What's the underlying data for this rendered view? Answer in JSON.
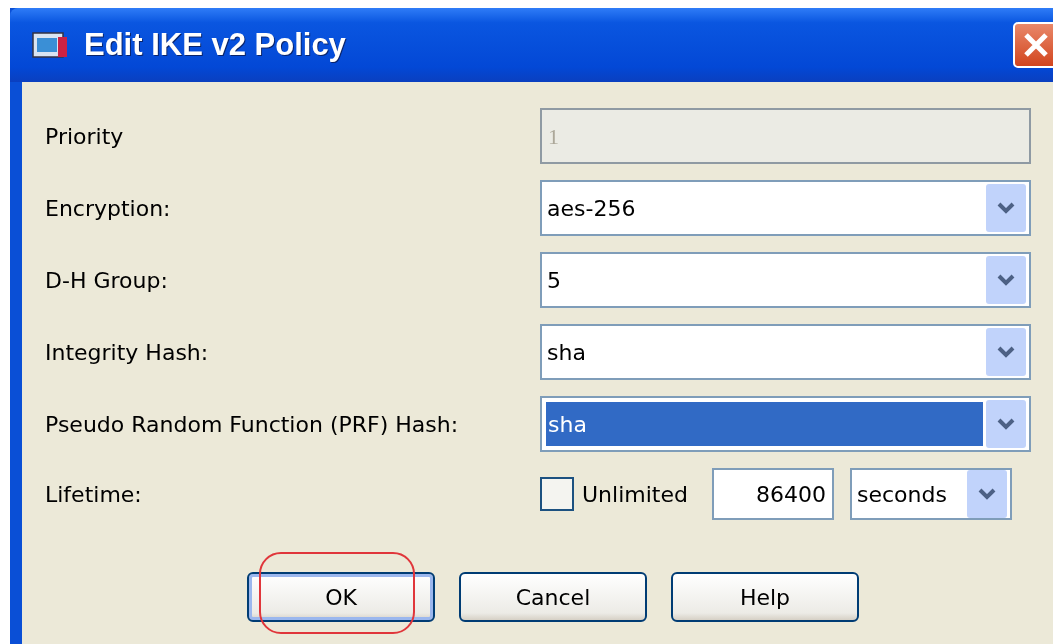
{
  "window": {
    "title": "Edit IKE v2 Policy"
  },
  "fields": [
    {
      "kind": "text",
      "label": "Priority",
      "value": "1",
      "disabled": true
    },
    {
      "kind": "select",
      "label": "Encryption:",
      "value": "aes-256",
      "selected": false
    },
    {
      "kind": "select",
      "label": "D-H Group:",
      "value": "5",
      "selected": false
    },
    {
      "kind": "select",
      "label": "Integrity Hash:",
      "value": "sha",
      "selected": false
    },
    {
      "kind": "select",
      "label": "Pseudo Random Function (PRF) Hash:",
      "value": "sha",
      "selected": true
    },
    {
      "kind": "lifetime",
      "label": "Lifetime:",
      "checkbox_label": "Unlimited",
      "checked": false,
      "value": "86400",
      "unit": "seconds"
    }
  ],
  "buttons": [
    {
      "label": "OK",
      "default": true,
      "highlighted": true
    },
    {
      "label": "Cancel",
      "default": false,
      "highlighted": false
    },
    {
      "label": "Help",
      "default": false,
      "highlighted": false
    }
  ]
}
